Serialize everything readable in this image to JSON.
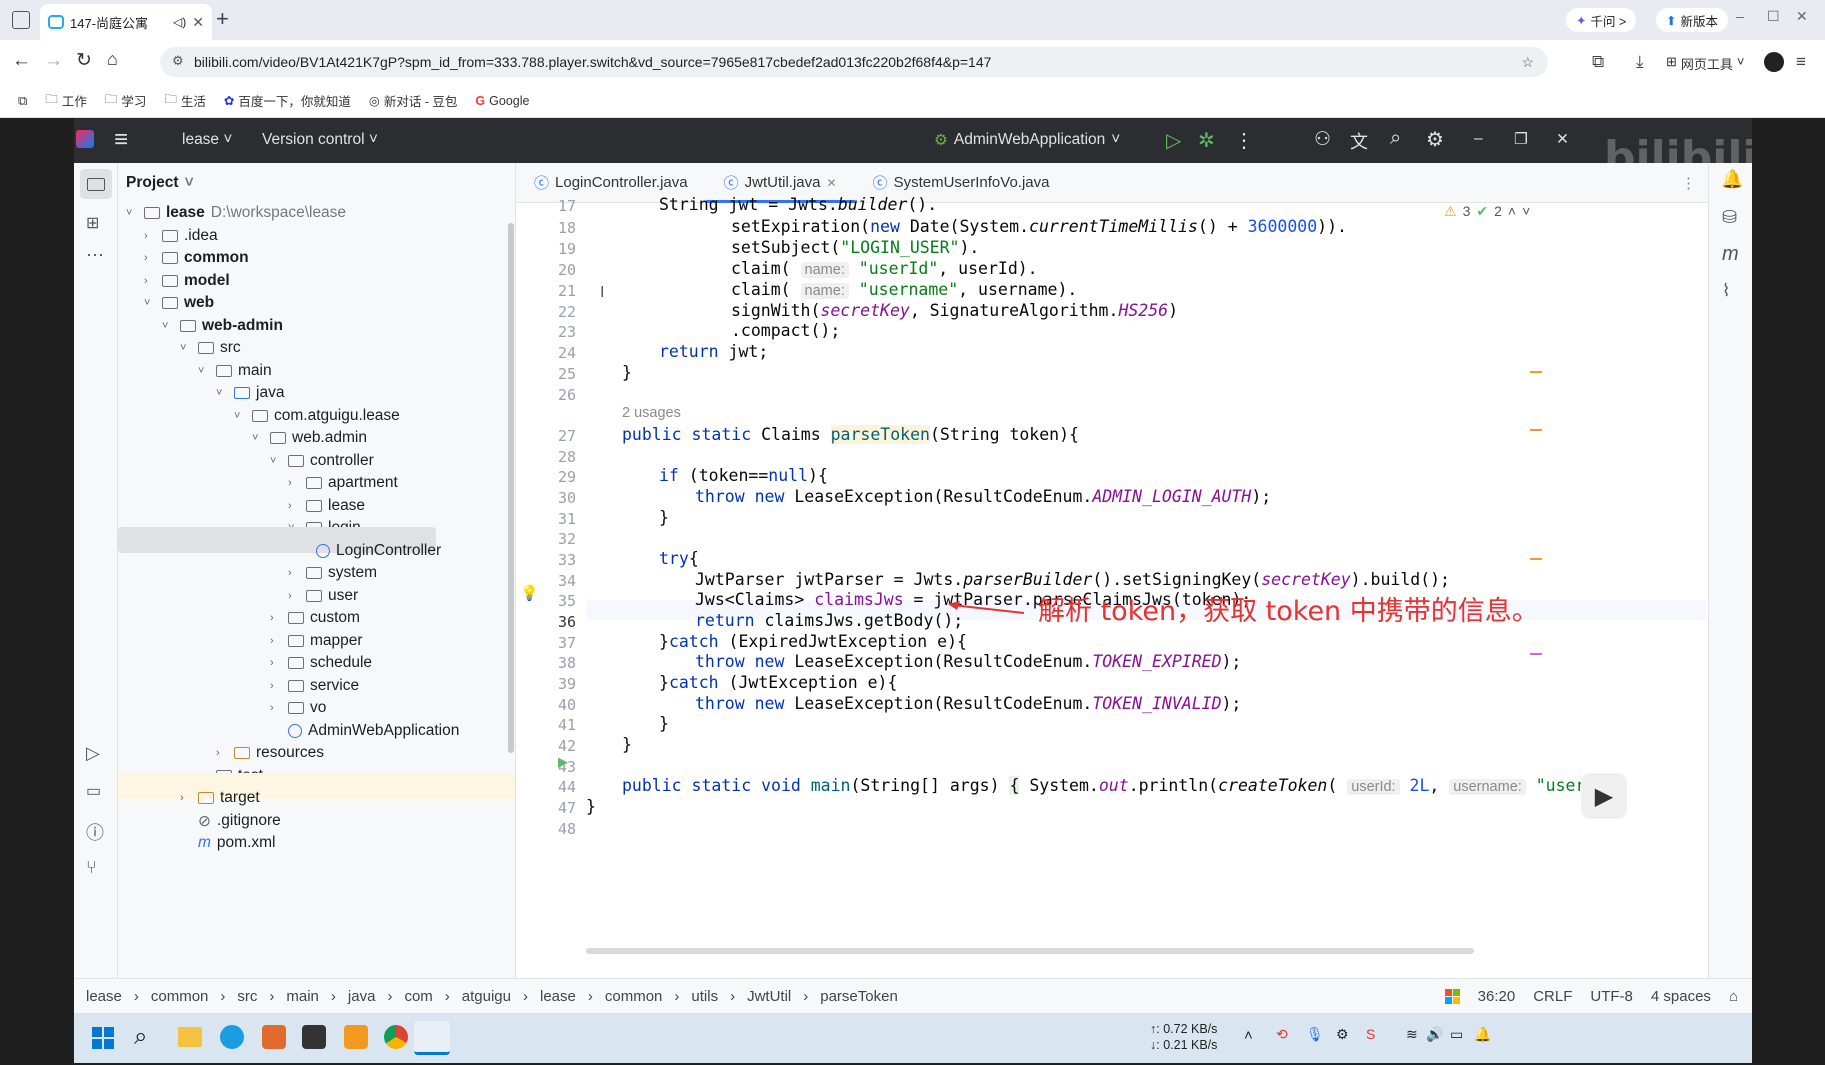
{
  "browser": {
    "tab_title": "147-尚庭公寓",
    "url": "bilibili.com/video/BV1At421K7gP?spm_id_from=333.788.player.switch&vd_source=7965e817cbedef2ad013fc220b2f68f4&p=147",
    "pill1": "千问 >",
    "pill2": "新版本",
    "tools": "网页工具",
    "bookmarks": [
      "工作",
      "学习",
      "生活",
      "百度一下，你就知道",
      "新对话 - 豆包",
      "Google"
    ]
  },
  "ide": {
    "project_name": "lease",
    "version_control": "Version control",
    "run_config": "AdminWebApplication",
    "project_label": "Project",
    "tabs": [
      "LoginController.java",
      "JwtUtil.java",
      "SystemUserInfoVo.java"
    ],
    "warn_count": "3",
    "ok_count": "2",
    "tree": [
      {
        "label": "lease",
        "extra": "D:\\workspace\\lease",
        "bold": true
      },
      {
        "label": ".idea"
      },
      {
        "label": "common",
        "bold": true
      },
      {
        "label": "model",
        "bold": true
      },
      {
        "label": "web",
        "bold": true
      },
      {
        "label": "web-admin",
        "bold": true
      },
      {
        "label": "src"
      },
      {
        "label": "main"
      },
      {
        "label": "java"
      },
      {
        "label": "com.atguigu.lease"
      },
      {
        "label": "web.admin"
      },
      {
        "label": "controller"
      },
      {
        "label": "apartment"
      },
      {
        "label": "lease"
      },
      {
        "label": "login"
      },
      {
        "label": "LoginController"
      },
      {
        "label": "system"
      },
      {
        "label": "user"
      },
      {
        "label": "custom"
      },
      {
        "label": "mapper"
      },
      {
        "label": "schedule"
      },
      {
        "label": "service"
      },
      {
        "label": "vo"
      },
      {
        "label": "AdminWebApplication"
      },
      {
        "label": "resources"
      },
      {
        "label": "test"
      },
      {
        "label": "target"
      },
      {
        "label": ".gitignore"
      },
      {
        "label": "pom.xml"
      }
    ],
    "line_numbers": [
      "17",
      "18",
      "19",
      "20",
      "21",
      "22",
      "23",
      "24",
      "25",
      "26",
      "",
      "27",
      "28",
      "29",
      "30",
      "31",
      "32",
      "33",
      "34",
      "35",
      "36",
      "37",
      "38",
      "39",
      "40",
      "41",
      "42",
      "43",
      "44",
      "47",
      "48"
    ],
    "usages": "2 usages",
    "annotation": "解析 token，获取 token 中携带的信息。",
    "breadcrumb": [
      "lease",
      "common",
      "src",
      "main",
      "java",
      "com",
      "atguigu",
      "lease",
      "common",
      "utils",
      "JwtUtil",
      "parseToken"
    ],
    "status": {
      "position": "36:20",
      "line_sep": "CRLF",
      "encoding": "UTF-8",
      "indent": "4 spaces"
    },
    "net": {
      "up": "↑: 0.72 KB/s",
      "down": "↓: 0.21 KB/s"
    }
  }
}
